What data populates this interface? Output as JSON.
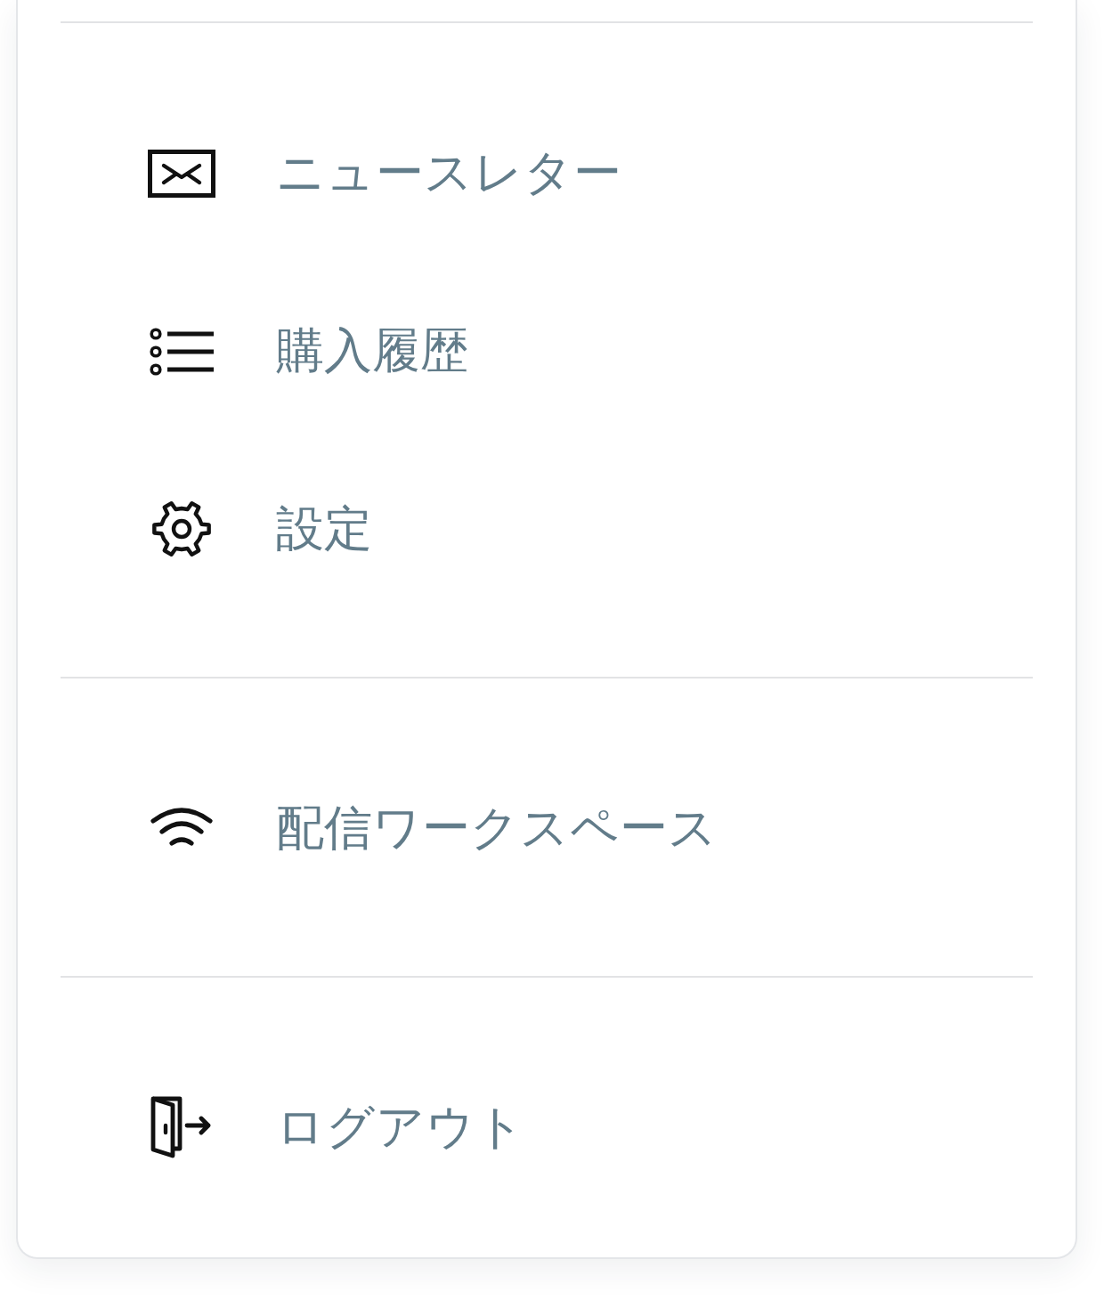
{
  "menu_groups": [
    {
      "items": [
        {
          "kind": "newsletter",
          "label": "ニュースレター"
        },
        {
          "kind": "history",
          "label": "購入履歴"
        },
        {
          "kind": "settings",
          "label": "設定"
        }
      ]
    },
    {
      "items": [
        {
          "kind": "workspace",
          "label": "配信ワークスペース"
        }
      ]
    },
    {
      "items": [
        {
          "kind": "logout",
          "label": "ログアウト"
        }
      ]
    }
  ]
}
